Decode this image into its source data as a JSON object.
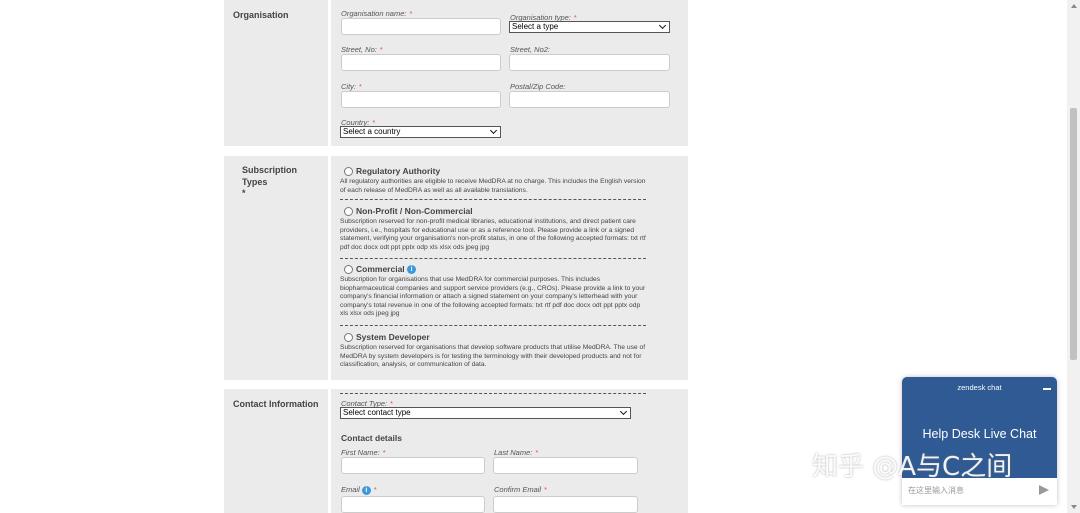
{
  "organisation": {
    "section_label": "Organisation",
    "name_label": "Organisation name:",
    "type_label": "Organisation type:",
    "type_value": "Select a type",
    "street_label": "Street, No:",
    "street2_label": "Street, No2:",
    "city_label": "City:",
    "postal_label": "Postal/Zip Code:",
    "country_label": "Country:",
    "country_value": "Select a country"
  },
  "subscription": {
    "label_line1": "Subscription",
    "label_line2": "Types *",
    "options": [
      {
        "title": "Regulatory Authority",
        "desc": "All regulatory authorities are eligible to receive MedDRA at no charge. This includes the English version of each release of MedDRA as well as all available translations."
      },
      {
        "title": "Non-Profit / Non-Commercial",
        "desc": "Subscription reserved for non-profit medical libraries, educational institutions, and direct patient care providers, i.e., hospitals for educational use or as a reference tool. Please provide a link or a signed statement, verifying your organisation's non-profit status, in one of the following accepted formats: txt rtf pdf doc docx odt ppt pptx odp xls xlsx ods jpeg jpg"
      },
      {
        "title": "Commercial",
        "desc": "Subscription for organisations that use MedDRA for commercial purposes. This includes biopharmaceutical companies and support service providers (e.g., CROs). Please provide a link to your company's financial information or attach a signed statement on your company's letterhead with your company's total revenue in one of the following accepted formats: txt rtf pdf doc docx odt ppt pptx odp xls xlsx ods jpeg jpg"
      },
      {
        "title": "System Developer",
        "desc": "Subscription reserved for organisations that develop software products that utilise MedDRA. The use of MedDRA by system developers is for testing the terminology with their developed products and not for classification, analysis, or communication of data."
      }
    ]
  },
  "contact": {
    "section_label": "Contact Information",
    "type_label": "Contact Type:",
    "type_value": "Select contact type",
    "details_heading": "Contact details",
    "first_name_label": "First Name:",
    "last_name_label": "Last Name:",
    "email_label": "Email",
    "confirm_email_label": "Confirm Email"
  },
  "required_marker": "*",
  "info_glyph": "i",
  "chat": {
    "brand": "zendesk chat",
    "title": "Help Desk Live Chat",
    "input_placeholder": "在这里输入消息"
  },
  "watermark": "知乎 @A与C之间",
  "colors": {
    "panel_bg": "#ebebeb",
    "chat_header": "#2f5a93",
    "required": "#d9534f",
    "info_icon": "#3a9ad9"
  }
}
